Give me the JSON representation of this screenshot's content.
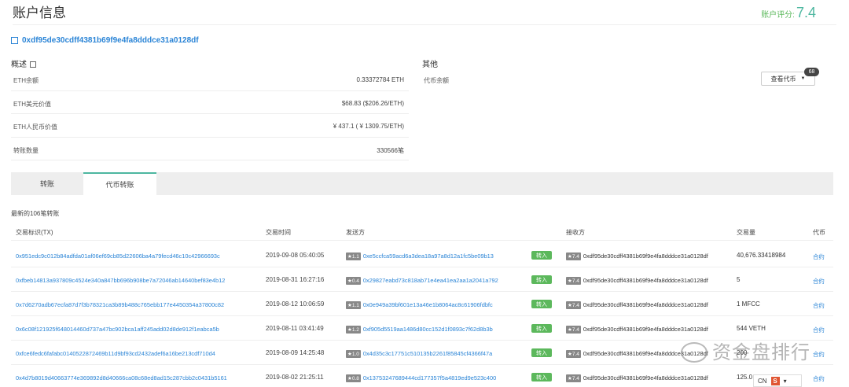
{
  "header": {
    "title": "账户信息",
    "score_label": "账户评分:",
    "score_value": "7.4"
  },
  "address": "0xdf95de30cdff4381b69f9e4fa8dddce31a0128df",
  "overview": {
    "title": "概述",
    "rows": [
      {
        "label": "ETH余额",
        "value": "0.33372784 ETH"
      },
      {
        "label": "ETH美元价值",
        "value": "$68.83 ($206.26/ETH)"
      },
      {
        "label": "ETH人民币价值",
        "value": "¥ 437.1 ( ¥ 1309.75/ETH)"
      },
      {
        "label": "转账数量",
        "value": "330566笔"
      }
    ]
  },
  "other": {
    "title": "其他",
    "token_balance_label": "代币余额",
    "token_button": "查看代币",
    "token_count": "68"
  },
  "tabs": [
    {
      "label": "转账"
    },
    {
      "label": "代币转账"
    }
  ],
  "latest_label": "最新的106笔转账",
  "columns": [
    "交易标识(TX)",
    "交易时间",
    "发送方",
    "接收方",
    "交易量",
    "代币"
  ],
  "rows": [
    {
      "tx": "0x951edc9c012b84adfda01af06ef69cb85d22606ba4a79fecd46c10c42966693c",
      "time": "2019-09-08 05:40:05",
      "from_score": "★1.1",
      "from": "0xe5ccfca59acd6a3dea18a97a8d12a1fc5be09b13",
      "dir": "转入",
      "to_score": "★7.4",
      "to": "0xdf95de30cdff4381b69f9e4fa8dddce31a0128df",
      "amount": "40,676.33418984",
      "token": "合约"
    },
    {
      "tx": "0xfbeb14813a937809c4524e340a847bb696b908be7a72046ab14640bef83e4b12",
      "time": "2019-08-31 16:27:16",
      "from_score": "★0.4",
      "from": "0x29827eabd73c818ab71e4ea41ea2aa1a2041a792",
      "dir": "转入",
      "to_score": "★7.4",
      "to": "0xdf95de30cdff4381b69f9e4fa8dddce31a0128df",
      "amount": "5",
      "token": "合约"
    },
    {
      "tx": "0x7d6270adb67ecfa87d7f3b78321ca3b89b488c765ebb177e4450354a37800c82",
      "time": "2019-08-12 10:06:59",
      "from_score": "★1.1",
      "from": "0x0e949a39bf601e13a46e1b8064ac8c61906fdbfc",
      "dir": "转入",
      "to_score": "★7.4",
      "to": "0xdf95de30cdff4381b69f9e4fa8dddce31a0128df",
      "amount": "1 MFCC",
      "token": "合约"
    },
    {
      "tx": "0x6c08f121925f648014460d737a47bc902bca1aff245add02d8de912f1eabca5b",
      "time": "2019-08-11 03:41:49",
      "from_score": "★1.2",
      "from": "0xf905d5519aa1486d80cc152d1f0893c7f62d8b3b",
      "dir": "转入",
      "to_score": "★7.4",
      "to": "0xdf95de30cdff4381b69f9e4fa8dddce31a0128df",
      "amount": "544 VETH",
      "token": "合约"
    },
    {
      "tx": "0xfce6fedc6fafabc0140522872469b11d9bf93cd2432adef6a16be213cdf710d4",
      "time": "2019-08-09 14:25:48",
      "from_score": "★1.0",
      "from": "0x4d35c3c17751c510135b2261f85845cf4366f47a",
      "dir": "转入",
      "to_score": "★7.4",
      "to": "0xdf95de30cdff4381b69f9e4fa8dddce31a0128df",
      "amount": "200",
      "token": "合约"
    },
    {
      "tx": "0x4d7b8019d40663774e369892d8d40666ca08c68ed8ad15c287cbb2c0431b5161",
      "time": "2019-08-02 21:25:11",
      "from_score": "★0.8",
      "from": "0x13753247689444cd177357f5a4819ed9e523c400",
      "dir": "转入",
      "to_score": "★7.4",
      "to": "0xdf95de30cdff4381b69f9e4fa8dddce31a0128df",
      "amount": "125.0",
      "token": "合约"
    }
  ],
  "watermark": "资金盘排行",
  "ime": {
    "lang": "CN",
    "icon_letter": "S"
  }
}
